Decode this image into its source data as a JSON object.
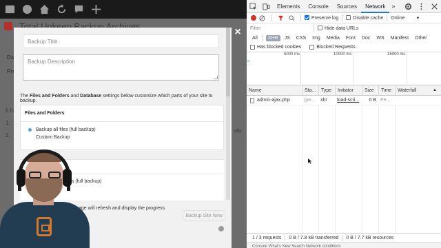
{
  "wordpress": {
    "page_title": "Total Upkeep Backup Archives",
    "side_labels": [
      "Da",
      "Pre"
    ],
    "side_fragments": [
      "It lo",
      "1.",
      "2."
    ],
    "right_fragment": "ally"
  },
  "modal": {
    "backup_title_placeholder": "Backup Title",
    "backup_description_placeholder": "Backup Description",
    "intro": {
      "prefix": "The ",
      "bold1": "Files and Folders",
      "middle": " and ",
      "bold2": "Database",
      "suffix": " settings below customize which parts of your site to backup."
    },
    "files_panel": {
      "heading": "Files and Folders",
      "option_full": "Backup all files (full backup)",
      "option_custom": "Custom Backup"
    },
    "lower_panel_option": "es (full backup)",
    "footer_note": "page will refresh and display the progress",
    "run_button": "Backup Site Now",
    "close_symbol": "×"
  },
  "devtools": {
    "tabs": [
      "Elements",
      "Console",
      "Sources",
      "Network"
    ],
    "active_tab": "Network",
    "more_tabs": "»",
    "toolbar": {
      "preserve_log": "Preserve log",
      "disable_cache": "Disable cache",
      "throttle": "Online"
    },
    "filter": {
      "placeholder": "Filter",
      "hide_data_urls": "Hide data URLs"
    },
    "types": [
      "All",
      "XHR",
      "JS",
      "CSS",
      "Img",
      "Media",
      "Font",
      "Doc",
      "WS",
      "Manifest",
      "Other"
    ],
    "active_type": "XHR",
    "has_blocked_cookies": "Has blocked cookies",
    "blocked_requests": "Blocked Requests",
    "timeline_ticks": [
      "5000 ms",
      "10000 ms",
      "15000 ms"
    ],
    "columns": [
      "Name",
      "Sta...",
      "Type",
      "Initiator",
      "Size",
      "Time",
      "Waterfall"
    ],
    "rows": [
      {
        "name": "admin-ajax.php",
        "status": "(pe...",
        "type": "xhr",
        "initiator": "load-scri...",
        "size": "0 B",
        "time": "Pe..."
      }
    ],
    "status_bar": {
      "requests": "1 / 3 requests",
      "transferred": "0 B / 7.8 kB transferred",
      "resources": "0 B / 7.7 kB resources"
    },
    "drawer_text": "Console  What's New  Search  Network conditions"
  },
  "colors": {
    "accent": "#1a73e8",
    "record": "#d93025",
    "plugin_logo": "#b3302b",
    "radio_selected": "#5aa0d6"
  }
}
